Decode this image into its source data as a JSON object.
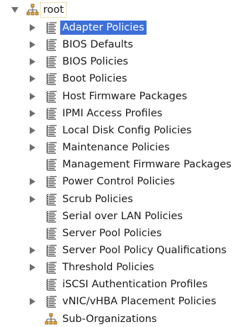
{
  "tree": {
    "root": {
      "label": "root",
      "expanded": true,
      "icon": "org-hierarchy-icon"
    },
    "items": [
      {
        "label": "Adapter Policies",
        "expandable": true,
        "selected": true,
        "icon": "policy-stack-icon"
      },
      {
        "label": "BIOS Defaults",
        "expandable": true,
        "selected": false,
        "icon": "policy-stack-icon"
      },
      {
        "label": "BIOS Policies",
        "expandable": true,
        "selected": false,
        "icon": "policy-stack-icon"
      },
      {
        "label": "Boot Policies",
        "expandable": true,
        "selected": false,
        "icon": "policy-stack-icon"
      },
      {
        "label": "Host Firmware Packages",
        "expandable": true,
        "selected": false,
        "icon": "policy-stack-icon"
      },
      {
        "label": "IPMI Access Profiles",
        "expandable": true,
        "selected": false,
        "icon": "policy-stack-icon"
      },
      {
        "label": "Local Disk Config Policies",
        "expandable": true,
        "selected": false,
        "icon": "policy-stack-icon"
      },
      {
        "label": "Maintenance Policies",
        "expandable": true,
        "selected": false,
        "icon": "policy-stack-icon"
      },
      {
        "label": "Management Firmware Packages",
        "expandable": false,
        "selected": false,
        "icon": "policy-stack-icon"
      },
      {
        "label": "Power Control Policies",
        "expandable": true,
        "selected": false,
        "icon": "policy-stack-icon"
      },
      {
        "label": "Scrub Policies",
        "expandable": true,
        "selected": false,
        "icon": "policy-stack-icon"
      },
      {
        "label": "Serial over LAN Policies",
        "expandable": false,
        "selected": false,
        "icon": "policy-stack-icon"
      },
      {
        "label": "Server Pool Policies",
        "expandable": false,
        "selected": false,
        "icon": "policy-stack-icon"
      },
      {
        "label": "Server Pool Policy Qualifications",
        "expandable": true,
        "selected": false,
        "icon": "policy-stack-icon"
      },
      {
        "label": "Threshold Policies",
        "expandable": true,
        "selected": false,
        "icon": "policy-stack-icon"
      },
      {
        "label": "iSCSI Authentication Profiles",
        "expandable": false,
        "selected": false,
        "icon": "policy-stack-icon"
      },
      {
        "label": "vNIC/vHBA Placement Policies",
        "expandable": true,
        "selected": false,
        "icon": "policy-stack-icon"
      },
      {
        "label": "Sub-Organizations",
        "expandable": false,
        "selected": false,
        "icon": "org-hierarchy-icon"
      }
    ]
  },
  "colors": {
    "selection": "#3d6fd9",
    "selection_text": "#ffffff",
    "text": "#1a1a1a",
    "toggle": "#6e6e6e",
    "root_focus_border": "#d9c56a"
  }
}
